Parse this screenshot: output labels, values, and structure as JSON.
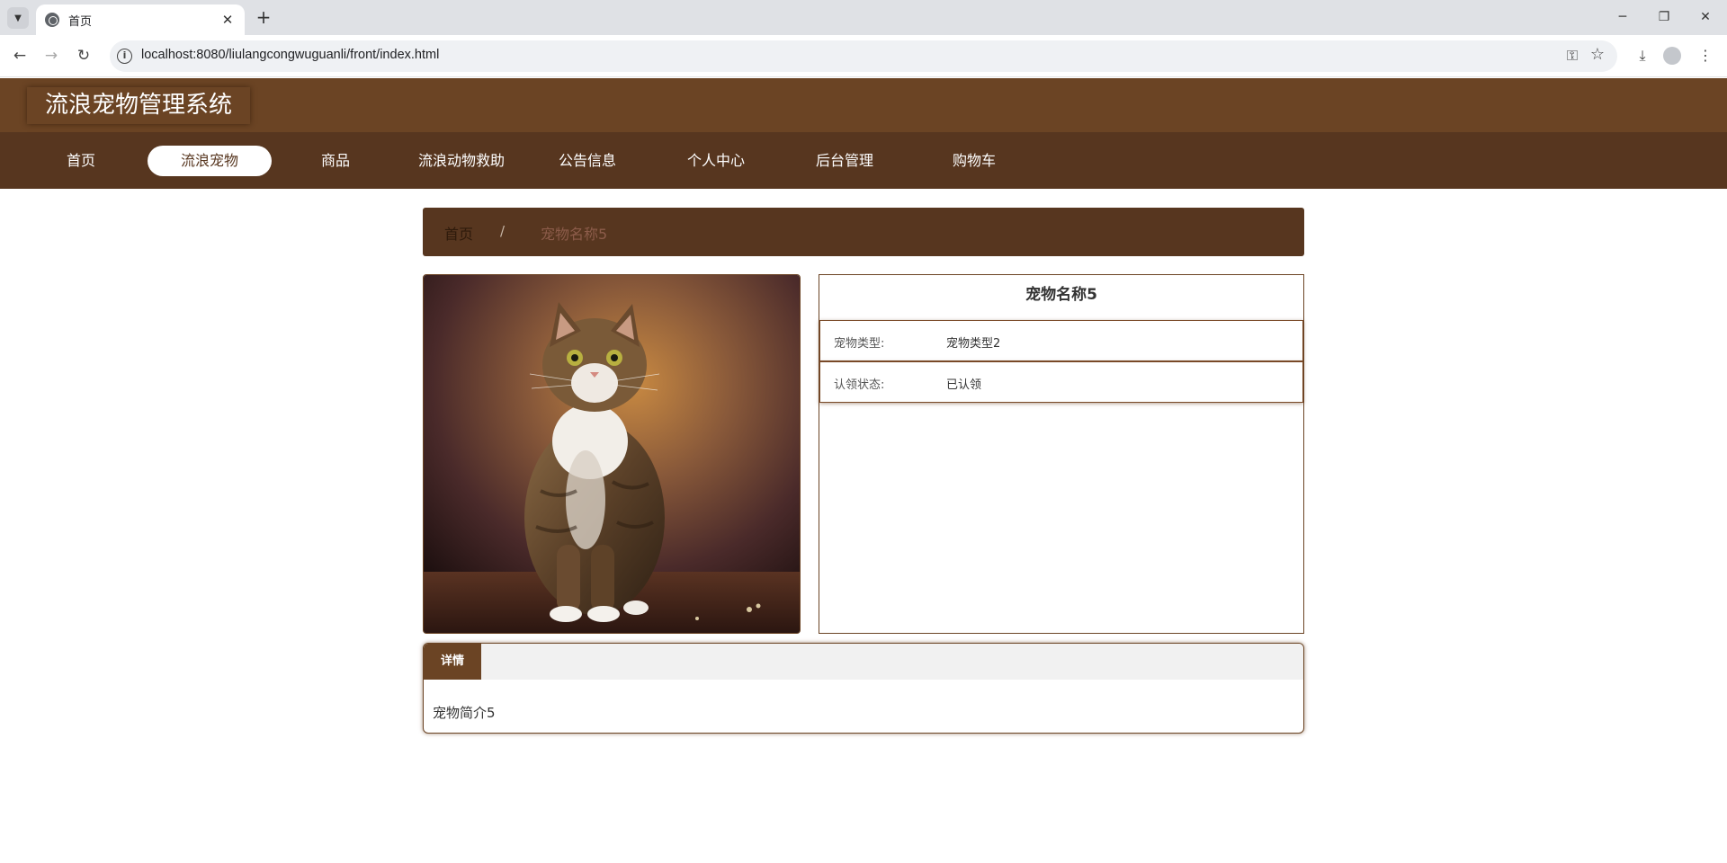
{
  "browser": {
    "tab_title": "首页",
    "url": "localhost:8080/liulangcongwuguanli/front/index.html"
  },
  "site": {
    "title": "流浪宠物管理系统",
    "nav": [
      {
        "label": "首页"
      },
      {
        "label": "流浪宠物"
      },
      {
        "label": "商品"
      },
      {
        "label": "流浪动物救助"
      },
      {
        "label": "公告信息"
      },
      {
        "label": "个人中心"
      },
      {
        "label": "后台管理"
      },
      {
        "label": "购物车"
      }
    ],
    "nav_active": "流浪宠物"
  },
  "breadcrumb": {
    "home": "首页",
    "separator": "/",
    "current": "宠物名称5"
  },
  "pet": {
    "name": "宠物名称5",
    "fields": [
      {
        "label": "宠物类型:",
        "value": "宠物类型2"
      },
      {
        "label": "认领状态:",
        "value": "已认领"
      }
    ],
    "photo_alt": "tabby cat photo"
  },
  "details": {
    "tab_label": "详情",
    "content": "宠物简介5"
  },
  "colors": {
    "header": "#6b4424",
    "nav": "#57361f",
    "accent_text": "#8c5c4a"
  }
}
